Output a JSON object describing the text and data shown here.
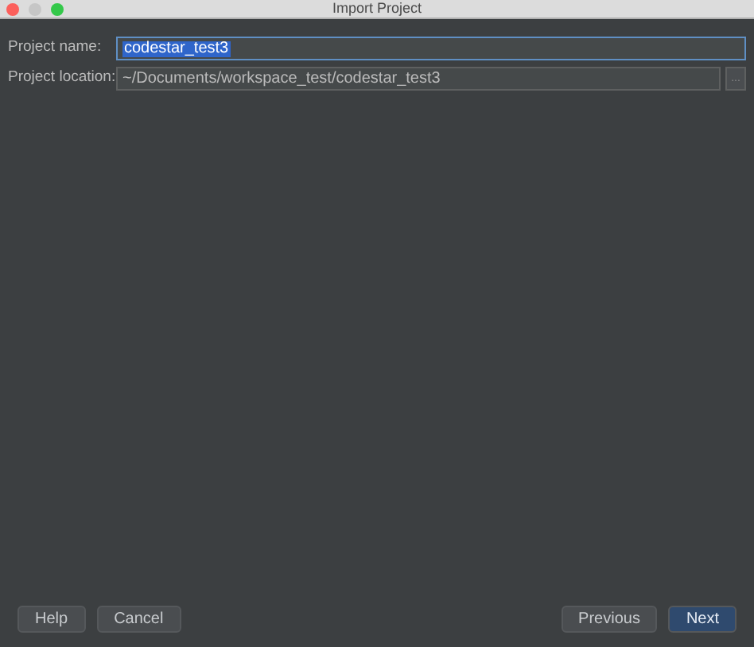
{
  "window": {
    "title": "Import Project"
  },
  "fields": [
    {
      "label": "Project name:",
      "value": "codestar_test3",
      "focused": true,
      "text_selected": true
    },
    {
      "label": "Project location:",
      "value": "~/Documents/workspace_test/codestar_test3",
      "focused": false,
      "text_selected": false,
      "browse": "..."
    }
  ],
  "buttons_left": [
    {
      "label": "Help",
      "kind": "normal"
    },
    {
      "label": "Cancel",
      "kind": "normal"
    }
  ],
  "buttons_right": [
    {
      "label": "Previous",
      "kind": "normal"
    },
    {
      "label": "Next",
      "kind": "default"
    }
  ]
}
